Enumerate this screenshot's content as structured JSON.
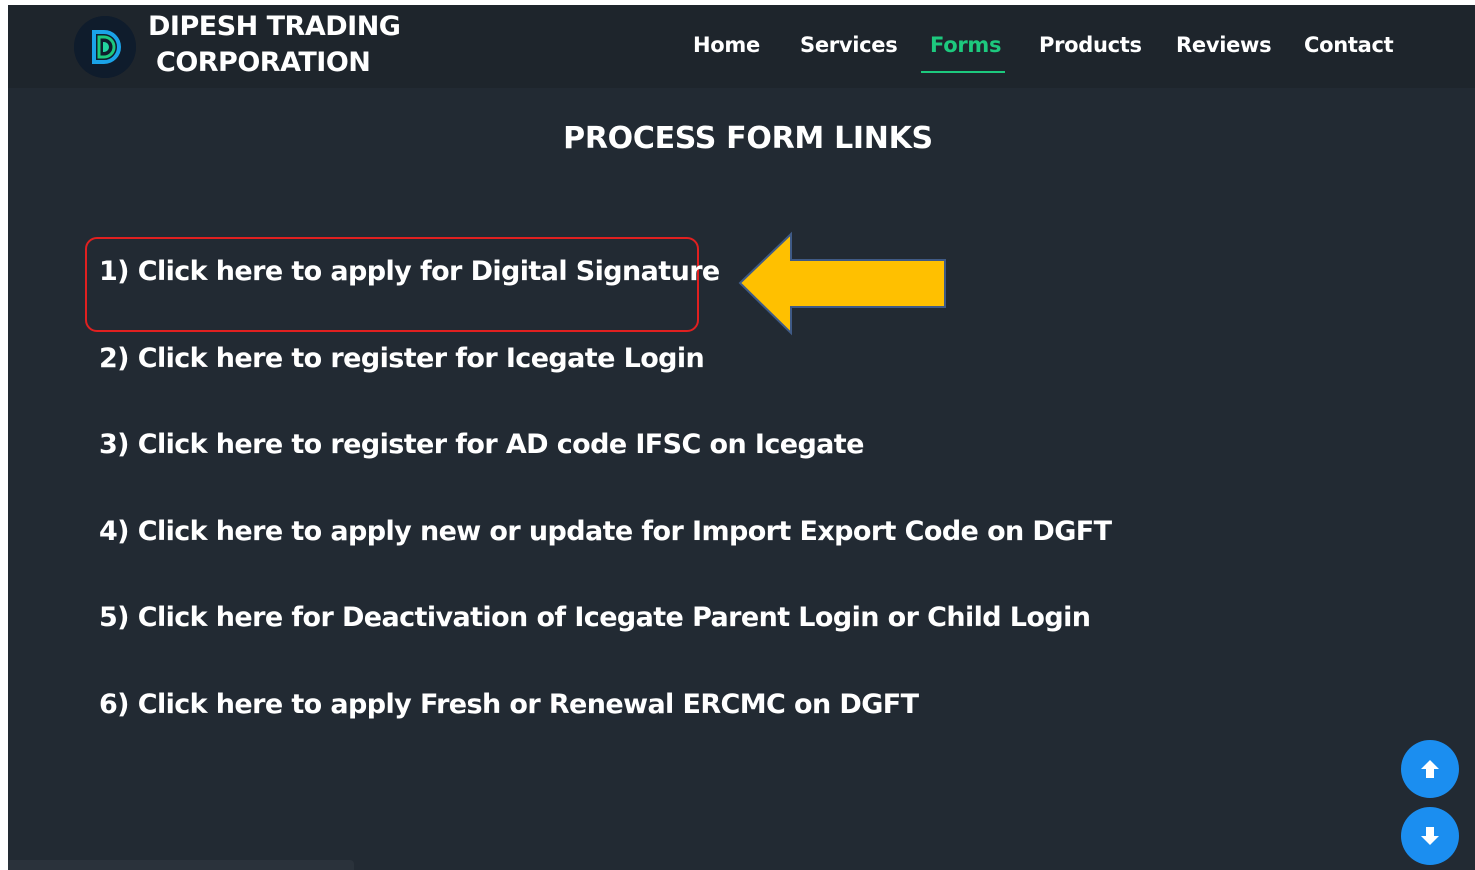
{
  "header": {
    "brand_line1": "DIPESH TRADING",
    "brand_line2": "CORPORATION",
    "logo_letter": "D"
  },
  "nav": {
    "items": [
      {
        "label": "Home",
        "active": false
      },
      {
        "label": "Services",
        "active": false
      },
      {
        "label": "Forms",
        "active": true
      },
      {
        "label": "Products",
        "active": false
      },
      {
        "label": "Reviews",
        "active": false
      },
      {
        "label": "Contact",
        "active": false
      }
    ]
  },
  "main": {
    "title": "PROCESS FORM LINKS",
    "links": [
      "1) Click here to apply for Digital Signature",
      "2) Click here to register for Icegate Login",
      "3) Click here to register for AD code IFSC on Icegate",
      "4) Click here to apply new or update for Import Export Code on DGFT",
      "5) Click here for Deactivation of Icegate Parent Login or Child Login",
      "6) Click here to apply Fresh or Renewal ERCMC on DGFT"
    ]
  },
  "colors": {
    "page_bg": "#222a33",
    "navbar_bg": "#1e252c",
    "active_nav": "#1dc97e",
    "highlight_border": "#e02020",
    "arrow_fill": "#ffc000",
    "scroll_button": "#1b8ef0"
  },
  "icons": {
    "scroll_up": "arrow-up-icon",
    "scroll_down": "arrow-down-icon",
    "annotation": "left-arrow-icon"
  }
}
